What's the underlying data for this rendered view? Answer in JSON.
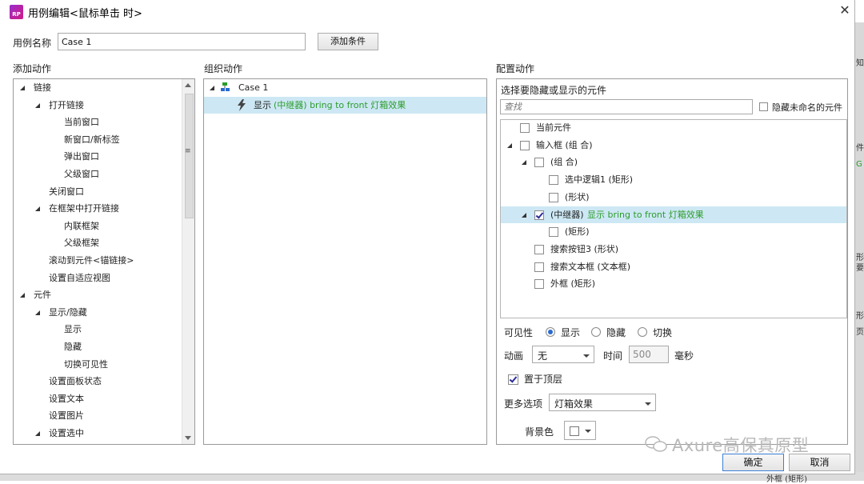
{
  "dialog": {
    "title": "用例编辑<鼠标单击 时>",
    "case_name_label": "用例名称",
    "case_name_value": "Case 1",
    "add_condition": "添加条件",
    "ok": "确定",
    "cancel": "取消"
  },
  "columns": {
    "add_action": "添加动作",
    "organize_action": "组织动作",
    "configure_action": "配置动作"
  },
  "actions_tree": [
    {
      "label": "链接",
      "level": 0,
      "expanded": true
    },
    {
      "label": "打开链接",
      "level": 1,
      "expanded": true
    },
    {
      "label": "当前窗口",
      "level": 2
    },
    {
      "label": "新窗口/新标签",
      "level": 2
    },
    {
      "label": "弹出窗口",
      "level": 2
    },
    {
      "label": "父级窗口",
      "level": 2
    },
    {
      "label": "关闭窗口",
      "level": 1
    },
    {
      "label": "在框架中打开链接",
      "level": 1,
      "expanded": true
    },
    {
      "label": "内联框架",
      "level": 2
    },
    {
      "label": "父级框架",
      "level": 2
    },
    {
      "label": "滚动到元件<锚链接>",
      "level": 1
    },
    {
      "label": "设置自适应视图",
      "level": 1
    },
    {
      "label": "元件",
      "level": 0,
      "expanded": true
    },
    {
      "label": "显示/隐藏",
      "level": 1,
      "expanded": true
    },
    {
      "label": "显示",
      "level": 2
    },
    {
      "label": "隐藏",
      "level": 2
    },
    {
      "label": "切换可见性",
      "level": 2
    },
    {
      "label": "设置面板状态",
      "level": 1
    },
    {
      "label": "设置文本",
      "level": 1
    },
    {
      "label": "设置图片",
      "level": 1
    },
    {
      "label": "设置选中",
      "level": 1,
      "expanded": true
    }
  ],
  "organize": {
    "case_label": "Case 1",
    "action_prefix": "显示 ",
    "action_detail": "(中继器) bring to front 灯箱效果"
  },
  "configure": {
    "header": "选择要隐藏或显示的元件",
    "search_placeholder": "查找",
    "hide_unnamed_label": "隐藏未命名的元件",
    "tree": [
      {
        "label": "当前元件",
        "level": 0,
        "checked": false
      },
      {
        "label": "输入框 (组 合)",
        "level": 0,
        "checked": false,
        "expanded": true
      },
      {
        "label": "(组 合)",
        "level": 1,
        "checked": false,
        "expanded": true
      },
      {
        "label": "选中逻辑1 (矩形)",
        "level": 2,
        "checked": false
      },
      {
        "label": "(形状)",
        "level": 2,
        "checked": false
      },
      {
        "label": "(中继器)",
        "level": 1,
        "checked": true,
        "expanded": true,
        "extra": "显示 bring to front 灯箱效果"
      },
      {
        "label": "(矩形)",
        "level": 2,
        "checked": false
      },
      {
        "label": "搜索按钮3 (形状)",
        "level": 1,
        "checked": false
      },
      {
        "label": "搜索文本框 (文本框)",
        "level": 1,
        "checked": false
      },
      {
        "label": "外框 (矩形)",
        "level": 1,
        "checked": false
      }
    ],
    "visibility_label": "可见性",
    "visibility_options": [
      "显示",
      "隐藏",
      "切换"
    ],
    "visibility_selected": "显示",
    "animation_label": "动画",
    "animation_value": "无",
    "time_label": "时间",
    "time_value": "500",
    "time_unit": "毫秒",
    "bring_front_label": "置于顶层",
    "bring_front_checked": true,
    "more_options_label": "更多选项",
    "more_options_value": "灯箱效果",
    "bg_color_label": "背景色"
  },
  "watermark": "Axure高保真原型",
  "background_fragments": {
    "right": [
      "知",
      "件",
      "G",
      "形",
      "要",
      "形",
      "页"
    ],
    "bottom": "外框 (矩形)"
  },
  "colors": {
    "selection": "#cde8f4",
    "green_text": "#2d9b2d",
    "logo": "#b0248f",
    "radio_on": "#2a6ad0"
  }
}
